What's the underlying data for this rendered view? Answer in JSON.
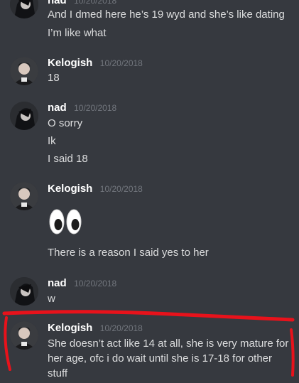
{
  "messages": [
    {
      "username": "nad",
      "timestamp": "10/20/2018",
      "lines": [
        "And I dmed here he’s 19 wyd and she’s like dating",
        "I’m like what"
      ]
    },
    {
      "username": "Kelogish",
      "timestamp": "10/20/2018",
      "lines": [
        "18"
      ]
    },
    {
      "username": "nad",
      "timestamp": "10/20/2018",
      "lines": [
        "O sorry",
        "Ik",
        "I said 18"
      ]
    },
    {
      "username": "Kelogish",
      "timestamp": "10/20/2018",
      "emoji": "eyes",
      "lines": [
        "There is a reason I said yes to her"
      ]
    },
    {
      "username": "nad",
      "timestamp": "10/20/2018",
      "lines": [
        "w"
      ]
    },
    {
      "username": "Kelogish",
      "timestamp": "10/20/2018",
      "lines": [
        "She doesn’t act like 14 at all, she is very mature for her age, ofc i do wait until she is 17-18 for other stuff"
      ]
    }
  ],
  "colors": {
    "background": "#36393f",
    "username": "#ffffff",
    "timestamp": "#72767d",
    "text": "#dcddde",
    "annotation": "#e8121b"
  }
}
